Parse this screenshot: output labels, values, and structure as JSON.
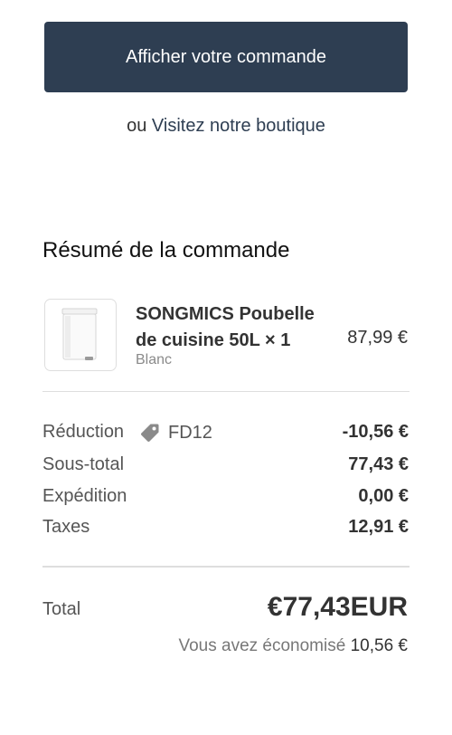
{
  "actions": {
    "view_order_label": "Afficher votre commande",
    "or_text": "ou",
    "visit_store_label": "Visitez notre boutique"
  },
  "summary": {
    "title": "Résumé de la commande",
    "item": {
      "name": "SONGMICS Poubelle de cuisine 50L × 1",
      "variant": "Blanc",
      "price": "87,99 €",
      "thumbnail_icon": "trash-bin-image"
    },
    "lines": {
      "discount_label": "Réduction",
      "discount_code": "FD12",
      "discount_icon": "tag-icon",
      "discount_value": "-10,56 €",
      "subtotal_label": "Sous-total",
      "subtotal_value": "77,43 €",
      "shipping_label": "Expédition",
      "shipping_value": "0,00 €",
      "taxes_label": "Taxes",
      "taxes_value": "12,91 €"
    },
    "total": {
      "label": "Total",
      "value": "€77,43EUR",
      "savings_label": "Vous avez économisé",
      "savings_amount": "10,56 €"
    }
  },
  "colors": {
    "primary_button_bg": "#2e3e52",
    "link": "#2e3e52",
    "text": "#333333",
    "muted": "#8a8a8a"
  }
}
